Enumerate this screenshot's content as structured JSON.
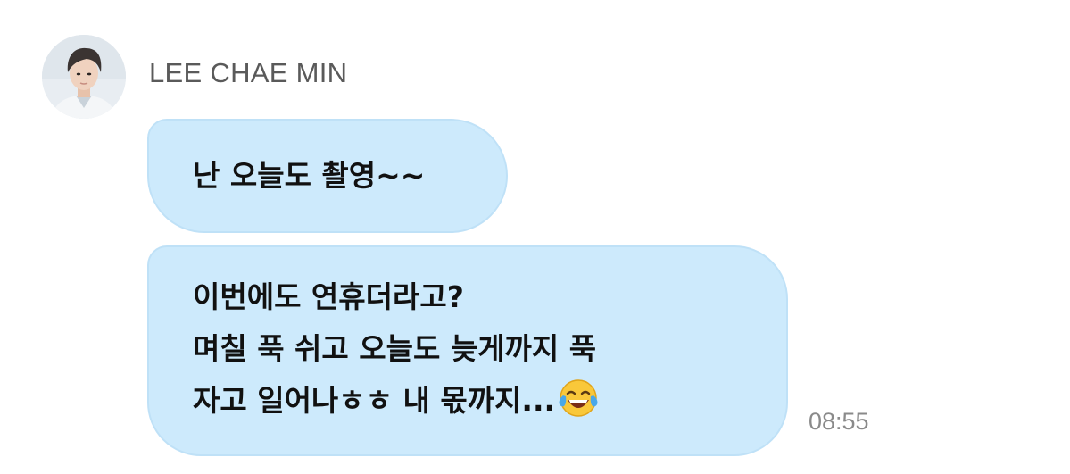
{
  "sender": {
    "name": "LEE CHAE MIN",
    "avatar_icon": "profile-photo"
  },
  "messages": [
    {
      "lines": [
        "난 오늘도 촬영~~"
      ]
    },
    {
      "lines": [
        "이번에도 연휴더라고?",
        "며칠 푹 쉬고 오늘도 늦게까지 푹",
        "자고 일어나ㅎㅎ 내 몫까지..."
      ],
      "trailing_emoji": "face-with-tears-of-joy",
      "time": "08:55"
    }
  ],
  "colors": {
    "bubble": "#cdeafc",
    "bubble_border": "#bfe1f7",
    "name": "#5a5a5a",
    "time": "#8a8a8a"
  }
}
